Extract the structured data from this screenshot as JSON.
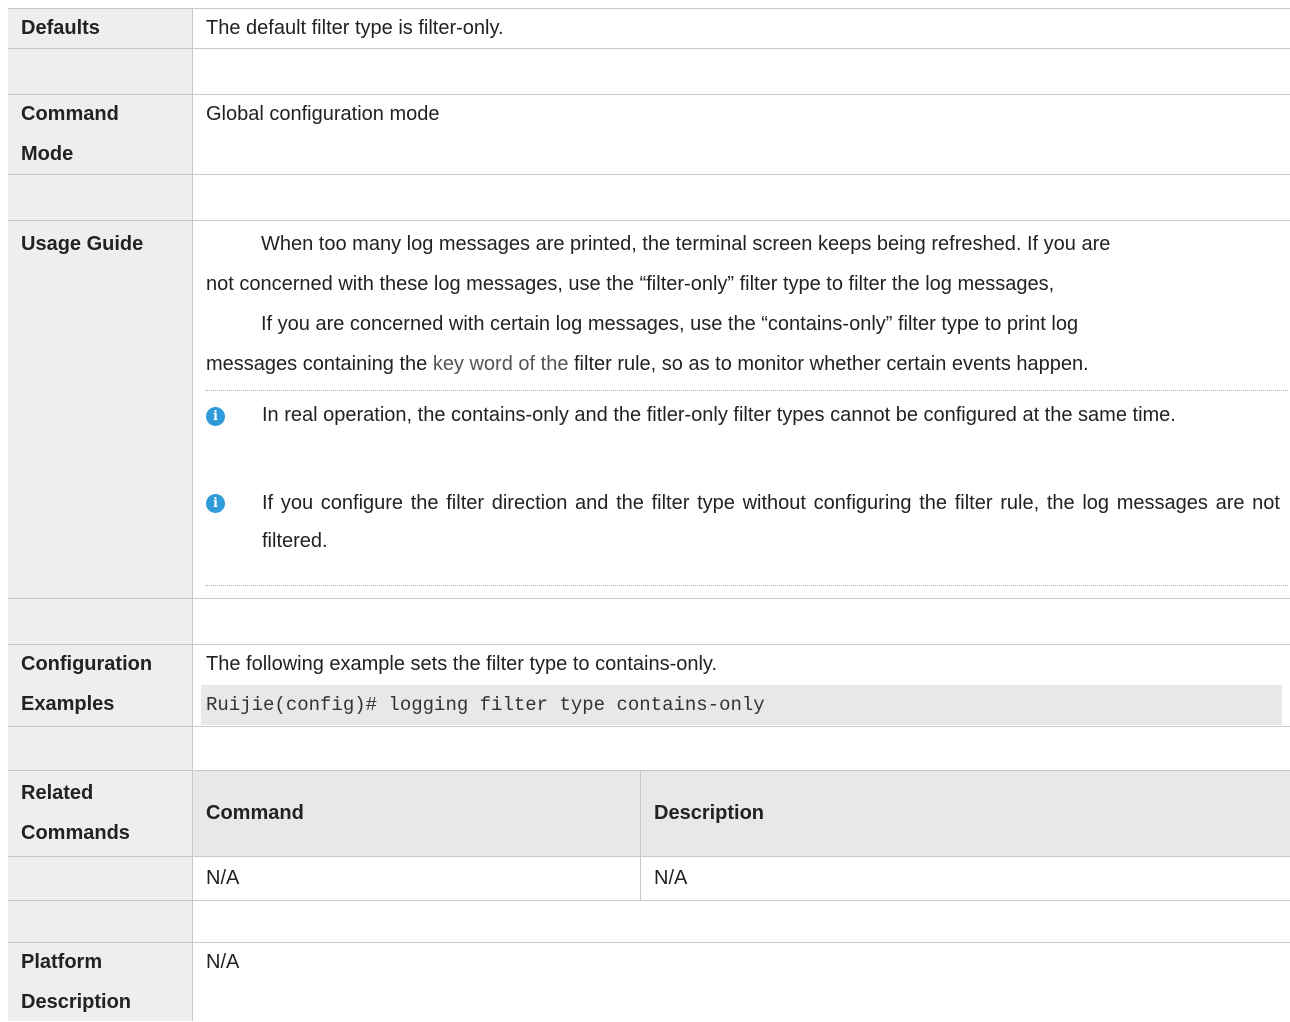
{
  "rows": {
    "defaults": {
      "label": "Defaults",
      "text": "The default filter type is filter-only."
    },
    "command_mode": {
      "label_line1": "Command",
      "label_line2": "Mode",
      "text": "Global configuration mode"
    },
    "usage_guide": {
      "label": "Usage Guide",
      "para1_line1": "When too many log messages are printed, the terminal screen keeps being refreshed. If you are",
      "para1_line2": "not concerned with these log messages, use the “filter-only” filter type to filter the log messages,",
      "para2_line1": "If you are concerned with certain log messages, use the “contains-only” filter type to print log",
      "para2_line2_a": "messages containing the ",
      "para2_line2_keyword": "key word of the",
      "para2_line2_b": " filter rule, so as to monitor whether certain events happen.",
      "note1": "In real operation, the contains-only and the fitler-only filter types cannot be configured at the same time.",
      "note2": "If you configure the filter direction and the filter type without configuring the filter rule, the log messages are not filtered."
    },
    "config_examples": {
      "label_line1": "Configuration",
      "label_line2": "Examples",
      "text": "The following example sets the filter type to contains-only.",
      "code": "Ruijie(config)# logging filter type contains-only"
    },
    "related_commands": {
      "label_line1": "Related",
      "label_line2": "Commands",
      "header_command": "Command",
      "header_description": "Description",
      "row_command": "N/A",
      "row_description": "N/A"
    },
    "platform_description": {
      "label_line1": "Platform",
      "label_line2": "Description",
      "text": "N/A"
    }
  },
  "colors": {
    "label_bg": "#eeeeee",
    "info_icon": "#2f9bd8",
    "code_bg": "#e8e8e8"
  },
  "icons": {
    "note": "info-icon"
  }
}
